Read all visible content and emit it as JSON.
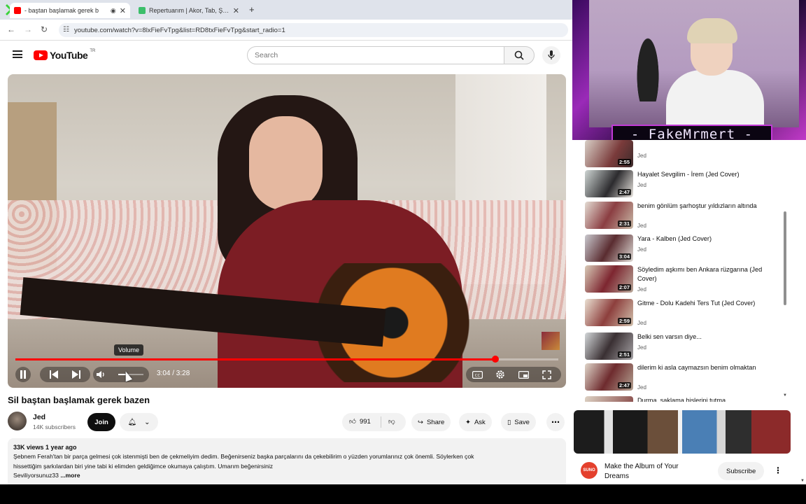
{
  "browser": {
    "tabs": [
      {
        "title": "- baştan başlamak gerek b",
        "active": true
      },
      {
        "title": "Repertuarım | Akor, Tab, Şarkı Sö",
        "active": false
      }
    ],
    "new_tab": "+",
    "url": "youtube.com/watch?v=8lxFieFvTpg&list=RD8txFieFvTpg&start_radio=1"
  },
  "youtube": {
    "logo_text": "YouTube",
    "region": "TR",
    "search_placeholder": "Search"
  },
  "player": {
    "tooltip": "Volume",
    "time": "3:04 / 3:28",
    "progress_fraction": 0.884,
    "volume_fraction": 0.3
  },
  "video": {
    "title": "Sil baştan başlamak gerek bazen",
    "channel": "Jed",
    "subscribers": "14K subscribers",
    "join_label": "Join",
    "likes": "991",
    "share_label": "Share",
    "ask_label": "Ask",
    "save_label": "Save",
    "views_date": "33K views  1 year ago",
    "description_line1": "Şebnem Ferah'tan bir parça gelmesi çok istenmişti ben de çekmeliyim dedim.  Beğenirseniz başka parçalarını da çekebilirim o yüzden yorumlarınız çok önemli. Söylerken çok",
    "description_line2": "hissettiğim şarkılardan biri yine tabi ki elimden geldiğimce okumaya çalıştım. Umarım beğenirsiniz",
    "description_line3": "Seviliyorsunuz33",
    "more_label": "...more"
  },
  "playlist": [
    {
      "title": "",
      "channel": "Jed",
      "duration": "2:55"
    },
    {
      "title": "Hayalet Sevgilim - İrem (Jed Cover)",
      "channel": "Jed",
      "duration": "2:47"
    },
    {
      "title": "benim gönlüm şarhoştur yıldızların altında",
      "channel": "Jed",
      "duration": "2:31"
    },
    {
      "title": "Yara - Kalben (Jed Cover)",
      "channel": "Jed",
      "duration": "3:04"
    },
    {
      "title": "Söyledim aşkımı ben Ankara rüzgarına (Jed Cover)",
      "channel": "Jed",
      "duration": "2:07"
    },
    {
      "title": "Gitme - Dolu Kadehi Ters Tut (Jed Cover)",
      "channel": "Jed",
      "duration": "2:59"
    },
    {
      "title": "Belki sen varsın diye...",
      "channel": "Jed",
      "duration": "2:51"
    },
    {
      "title": "dilerim ki asla caymazsın benim olmaktan",
      "channel": "Jed",
      "duration": "2:47"
    },
    {
      "title": "Durma, saklama hislerini tutma",
      "channel": "",
      "duration": ""
    }
  ],
  "webcam": {
    "streamer_name": "- FakeMrmert -"
  },
  "ad": {
    "logo_text": "SUNO",
    "title": "Make the Album of Your Dreams",
    "subscribe_label": "Subscribe"
  },
  "colors": {
    "youtube_red": "#ff0000",
    "progress_red": "#ff0000",
    "overlay_purple": "#c23ad6"
  }
}
